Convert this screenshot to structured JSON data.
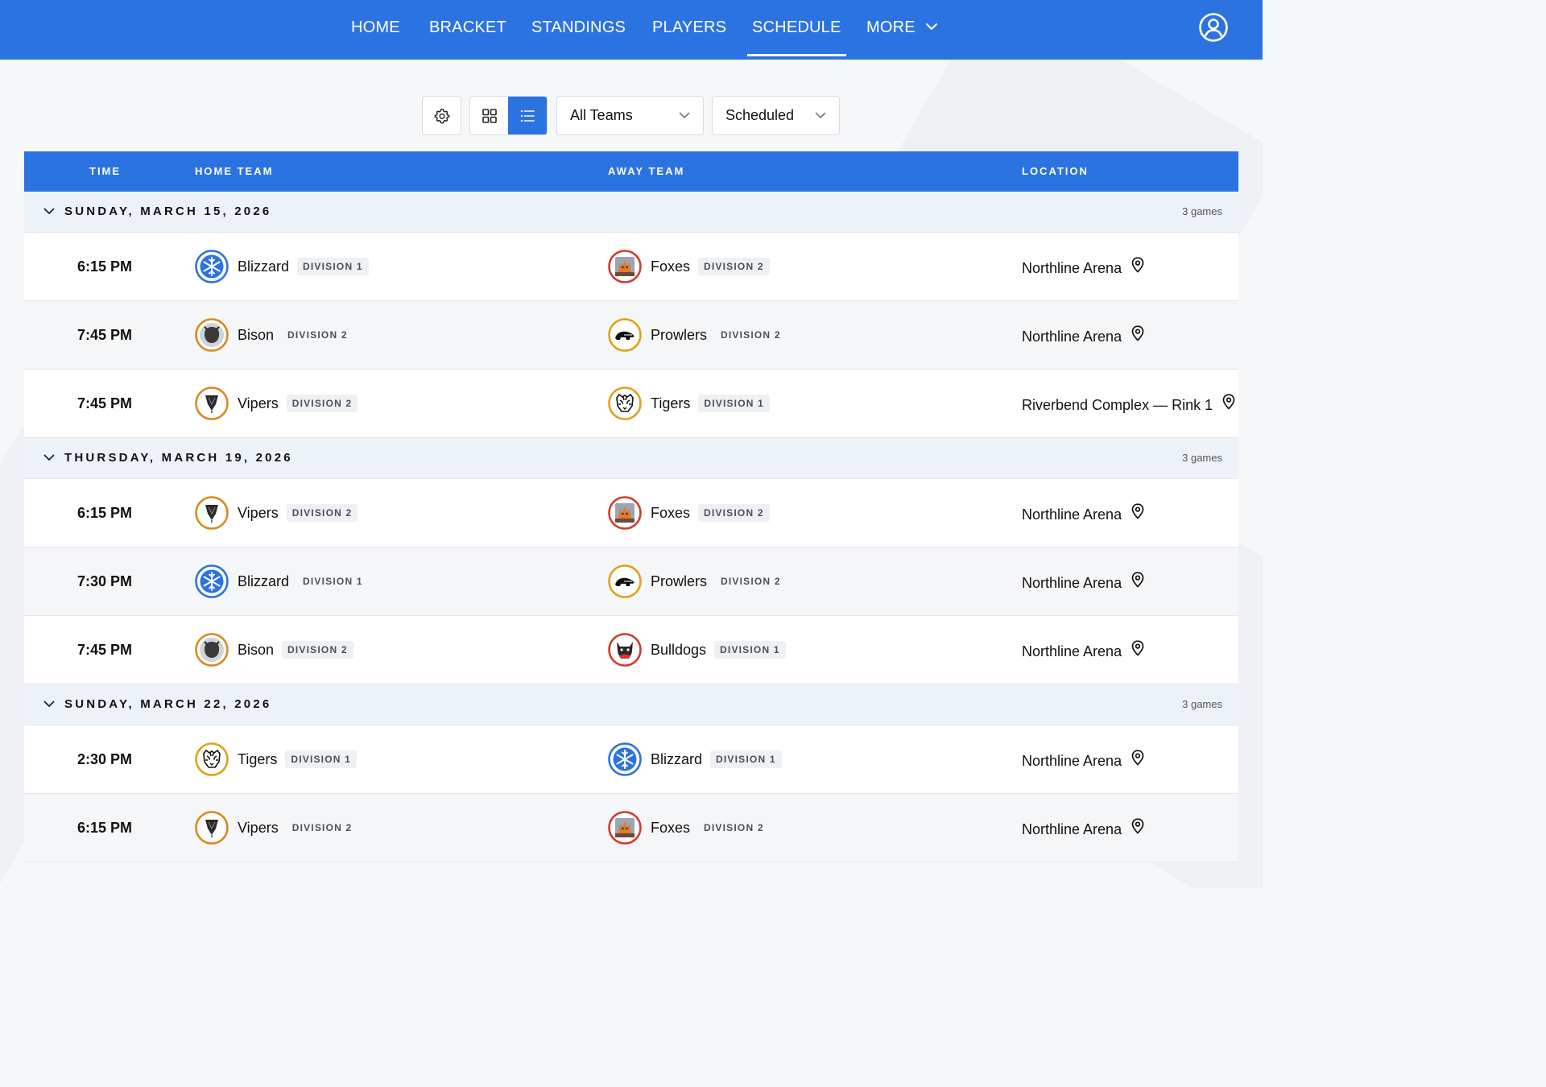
{
  "nav": {
    "items": [
      "HOME",
      "BRACKET",
      "STANDINGS",
      "PLAYERS",
      "SCHEDULE",
      "MORE"
    ],
    "active": "SCHEDULE"
  },
  "toolbar": {
    "team_filter": "All Teams",
    "status_filter": "Scheduled"
  },
  "table": {
    "headers": {
      "time": "TIME",
      "home": "HOME TEAM",
      "away": "AWAY TEAM",
      "location": "LOCATION"
    },
    "groups": [
      {
        "date": "SUNDAY, MARCH 15, 2026",
        "count": "3 games",
        "games": [
          {
            "time": "6:15 PM",
            "home": {
              "name": "Blizzard",
              "division": "DIVISION 1",
              "logo": "snowflake"
            },
            "away": {
              "name": "Foxes",
              "division": "DIVISION 2",
              "logo": "fox"
            },
            "location": "Northline Arena"
          },
          {
            "time": "7:45 PM",
            "home": {
              "name": "Bison",
              "division": "DIVISION 2",
              "logo": "bison"
            },
            "away": {
              "name": "Prowlers",
              "division": "DIVISION 2",
              "logo": "prowler"
            },
            "location": "Northline Arena"
          },
          {
            "time": "7:45 PM",
            "home": {
              "name": "Vipers",
              "division": "DIVISION 2",
              "logo": "viper"
            },
            "away": {
              "name": "Tigers",
              "division": "DIVISION 1",
              "logo": "tiger"
            },
            "location": "Riverbend Complex — Rink 1"
          }
        ]
      },
      {
        "date": "THURSDAY, MARCH 19, 2026",
        "count": "3 games",
        "games": [
          {
            "time": "6:15 PM",
            "home": {
              "name": "Vipers",
              "division": "DIVISION 2",
              "logo": "viper"
            },
            "away": {
              "name": "Foxes",
              "division": "DIVISION 2",
              "logo": "fox"
            },
            "location": "Northline Arena"
          },
          {
            "time": "7:30 PM",
            "home": {
              "name": "Blizzard",
              "division": "DIVISION 1",
              "logo": "snowflake"
            },
            "away": {
              "name": "Prowlers",
              "division": "DIVISION 2",
              "logo": "prowler"
            },
            "location": "Northline Arena"
          },
          {
            "time": "7:45 PM",
            "home": {
              "name": "Bison",
              "division": "DIVISION 2",
              "logo": "bison"
            },
            "away": {
              "name": "Bulldogs",
              "division": "DIVISION 1",
              "logo": "bulldog"
            },
            "location": "Northline Arena"
          }
        ]
      },
      {
        "date": "SUNDAY, MARCH 22, 2026",
        "count": "3 games",
        "games": [
          {
            "time": "2:30 PM",
            "home": {
              "name": "Tigers",
              "division": "DIVISION 1",
              "logo": "tiger"
            },
            "away": {
              "name": "Blizzard",
              "division": "DIVISION 1",
              "logo": "snowflake"
            },
            "location": "Northline Arena"
          },
          {
            "time": "6:15 PM",
            "home": {
              "name": "Vipers",
              "division": "DIVISION 2",
              "logo": "viper"
            },
            "away": {
              "name": "Foxes",
              "division": "DIVISION 2",
              "logo": "fox"
            },
            "location": "Northline Arena"
          }
        ]
      }
    ]
  },
  "colors": {
    "primary": "#2c73e2",
    "group_bg": "#edf1f8",
    "ring_blue": "#2c73e2",
    "ring_orange": "#d98a1e",
    "ring_red": "#d33a2c",
    "ring_gold": "#e0a11b"
  }
}
